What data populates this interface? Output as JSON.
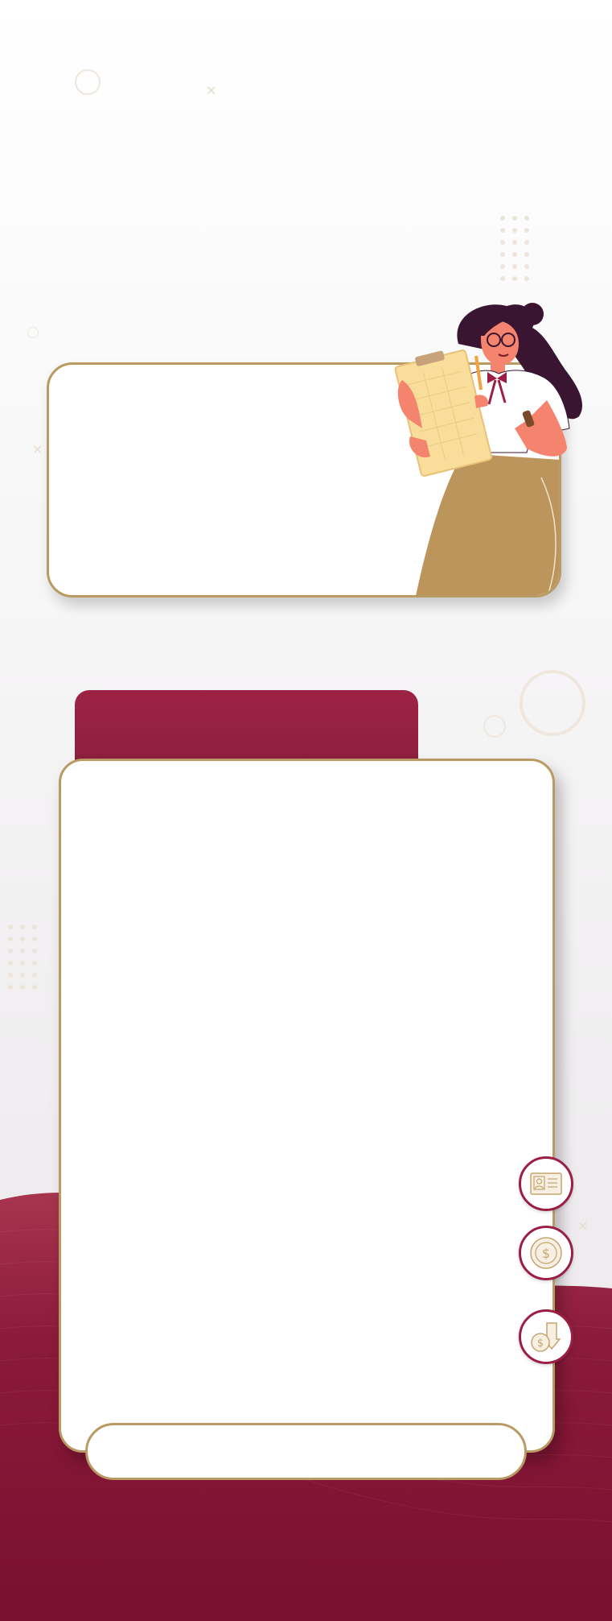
{
  "colors": {
    "maroon": "#9b1f45",
    "maroon_dark": "#7e1231",
    "gold": "#b99a63",
    "background": "#f6f5f6"
  },
  "top_card": {
    "text": ""
  },
  "main_panel": {
    "header_text": "",
    "body_text": ""
  },
  "bottom_bar": {
    "text": ""
  },
  "side_buttons": [
    {
      "icon": "id-card-icon"
    },
    {
      "icon": "dollar-coin-icon"
    },
    {
      "icon": "money-transfer-icon"
    }
  ]
}
